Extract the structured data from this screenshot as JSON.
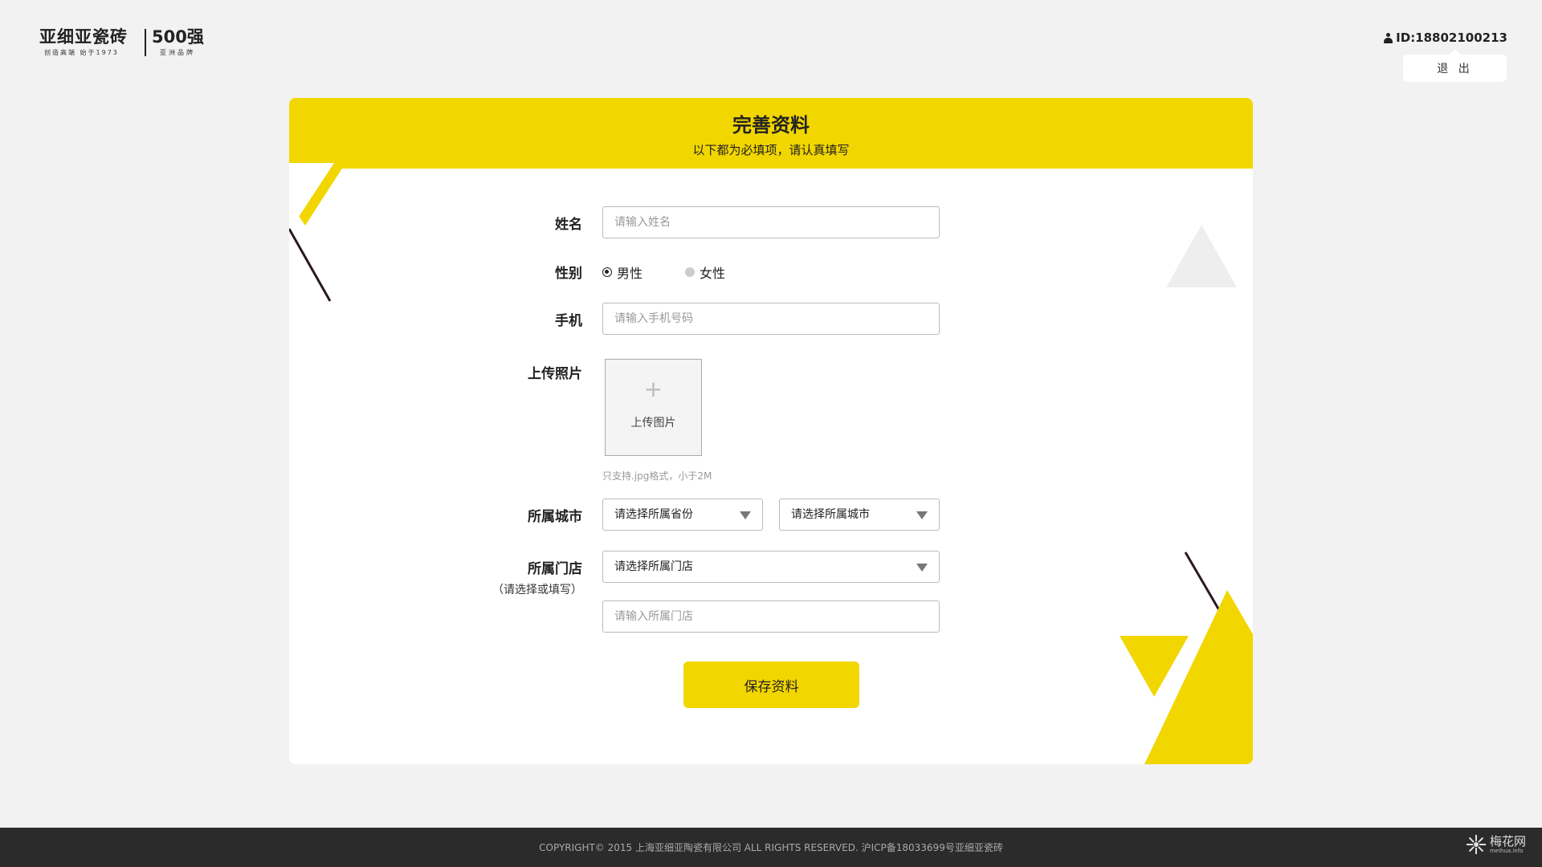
{
  "header": {
    "logo": {
      "brand": "亚细亚瓷砖",
      "tagline": "创造高端 始于1973",
      "rank": "500强",
      "rank_sub": "亚洲品牌"
    },
    "user_id": "ID:18802100213",
    "logout_label": "退 出"
  },
  "form": {
    "title": "完善资料",
    "subtitle": "以下都为必填项，请认真填写",
    "name": {
      "label": "姓名",
      "placeholder": "请输入姓名"
    },
    "gender": {
      "label": "性别",
      "options": [
        "男性",
        "女性"
      ],
      "selected": "男性"
    },
    "phone": {
      "label": "手机",
      "placeholder": "请输入手机号码"
    },
    "photo": {
      "label": "上传照片",
      "upload_text": "上传图片",
      "plus": "+",
      "hint": "只支持.jpg格式，小于2M"
    },
    "city": {
      "label": "所属城市",
      "province_placeholder": "请选择所属省份",
      "city_placeholder": "请选择所属城市"
    },
    "store": {
      "label": "所属门店",
      "sublabel": "（请选择或填写）",
      "select_placeholder": "请选择所属门店",
      "input_placeholder": "请输入所属门店"
    },
    "save_label": "保存资料"
  },
  "footer": {
    "copyright": "COPYRIGHT© 2015 上海亚细亚陶瓷有限公司 ALL RIGHTS RESERVED. 沪ICP备18033699号亚细亚瓷砖",
    "watermark_name": "梅花网",
    "watermark_url": "meihua.info"
  },
  "colors": {
    "accent": "#f2d600",
    "background": "#f2f2f2",
    "footer": "#2b2b2b",
    "decoration_line": "#2a1a1a",
    "decoration_gray": "#eeeeee"
  }
}
